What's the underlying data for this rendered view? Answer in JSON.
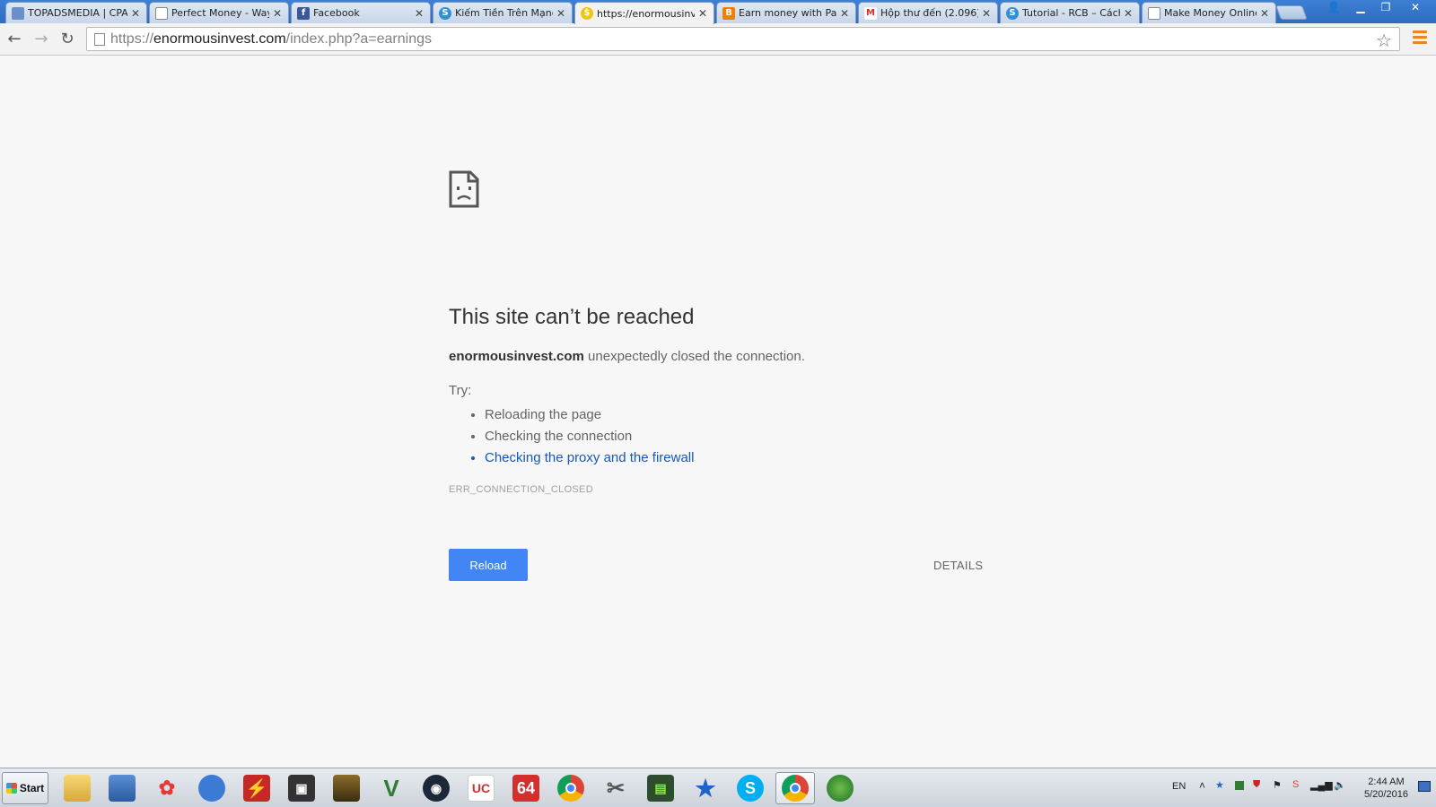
{
  "browser": {
    "tabs": [
      {
        "title": "TOPADSMEDIA | CPA",
        "favicon": "globe-favicon",
        "color": "#6b8fc8"
      },
      {
        "title": "Perfect Money - Way",
        "favicon": "page-favicon",
        "color": "#ffffff"
      },
      {
        "title": "Facebook",
        "favicon": "facebook-favicon",
        "color": "#3b5998"
      },
      {
        "title": "Kiếm Tiền Trên Mạng",
        "favicon": "s-favicon",
        "color": "#2f8fd8"
      },
      {
        "title": "https://enormousinve",
        "favicon": "loading-favicon",
        "color": "#f1c40f"
      },
      {
        "title": "Earn money with Pad",
        "favicon": "blogger-favicon",
        "color": "#f57d00"
      },
      {
        "title": "Hộp thư đến (2.096)",
        "favicon": "gmail-favicon",
        "color": "#d93025"
      },
      {
        "title": "Tutorial - RCB – Cách",
        "favicon": "s-favicon",
        "color": "#2f8fd8"
      },
      {
        "title": "Make Money Online w",
        "favicon": "page-favicon",
        "color": "#ffffff"
      }
    ],
    "active_tab": 4,
    "url_scheme": "https://",
    "url_host": "enormousinvest.com",
    "url_path": "/index.php?a=earnings"
  },
  "error_page": {
    "title": "This site can’t be reached",
    "host": "enormousinvest.com",
    "message": " unexpectedly closed the connection.",
    "try_label": "Try:",
    "suggestions": [
      "Reloading the page",
      "Checking the connection",
      "Checking the proxy and the firewall"
    ],
    "error_code": "ERR_CONNECTION_CLOSED",
    "reload_label": "Reload",
    "details_label": "DETAILS",
    "accent": "#4285f4",
    "link_color": "#1a56b8"
  },
  "taskbar": {
    "start_label": "Start",
    "language": "EN",
    "time": "2:44 AM",
    "date": "5/20/2016",
    "apps": [
      "file-explorer-icon",
      "network-monitor-icon",
      "molecule-icon",
      "shield-app-icon",
      "flash-icon",
      "monitor-app-icon",
      "game-icon",
      "gta-v-icon",
      "steam-icon",
      "uc-icon",
      "64-icon",
      "chrome-icon",
      "tools-icon",
      "terminal-icon",
      "star-app-icon",
      "skype-icon",
      "chrome-active-icon",
      "idm-icon"
    ],
    "badge_64": "64"
  }
}
